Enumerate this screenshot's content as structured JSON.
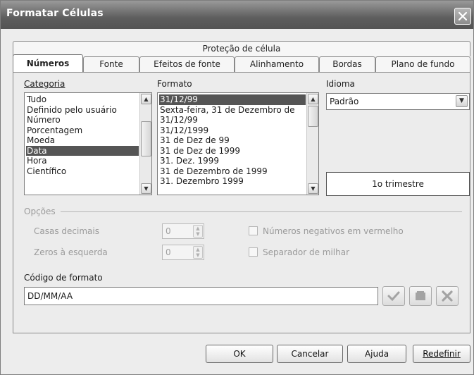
{
  "window": {
    "title": "Formatar Células",
    "close_icon": "close-icon"
  },
  "tabs_top": [
    {
      "label": "Proteção de célula"
    }
  ],
  "tabs": [
    {
      "label": "Números",
      "active": true
    },
    {
      "label": "Fonte"
    },
    {
      "label": "Efeitos de fonte"
    },
    {
      "label": "Alinhamento"
    },
    {
      "label": "Bordas"
    },
    {
      "label": "Plano de fundo"
    }
  ],
  "categoria": {
    "label": "Categoria",
    "items": [
      "Tudo",
      "Definido pelo usuário",
      "Número",
      "Porcentagem",
      "Moeda",
      "Data",
      "Hora",
      "Científico"
    ],
    "selected": "Data"
  },
  "formato": {
    "label": "Formato",
    "items": [
      "31/12/99",
      "Sexta-feira, 31 de Dezembro de",
      "31/12/99",
      "31/12/1999",
      "31 de Dez de 99",
      "31 de Dez de 1999",
      "31. Dez. 1999",
      "31 de Dezembro de 1999",
      "31. Dezembro 1999"
    ],
    "selected": "31/12/99"
  },
  "idioma": {
    "label": "Idioma",
    "value": "Padrão"
  },
  "preview": {
    "text": "1o trimestre"
  },
  "opcoes": {
    "label": "Opções",
    "casas_decimais": {
      "label": "Casas decimais",
      "value": "0"
    },
    "zeros_esquerda": {
      "label": "Zeros à esquerda",
      "value": "0"
    },
    "negativos": {
      "label": "Números negativos em vermelho",
      "checked": false
    },
    "separador": {
      "label": "Separador de milhar",
      "checked": false
    }
  },
  "codigo": {
    "label": "Código de formato",
    "value": "DD/MM/AA"
  },
  "code_tools": [
    {
      "icon": "checkmark-icon"
    },
    {
      "icon": "comment-icon"
    },
    {
      "icon": "delete-icon"
    }
  ],
  "buttons": {
    "ok": "OK",
    "cancelar": "Cancelar",
    "ajuda": "Ajuda",
    "redefinir": "Redefinir"
  },
  "colors": {
    "titlebar": "#5e5e5e",
    "selection": "#555555",
    "background": "#ededed"
  }
}
